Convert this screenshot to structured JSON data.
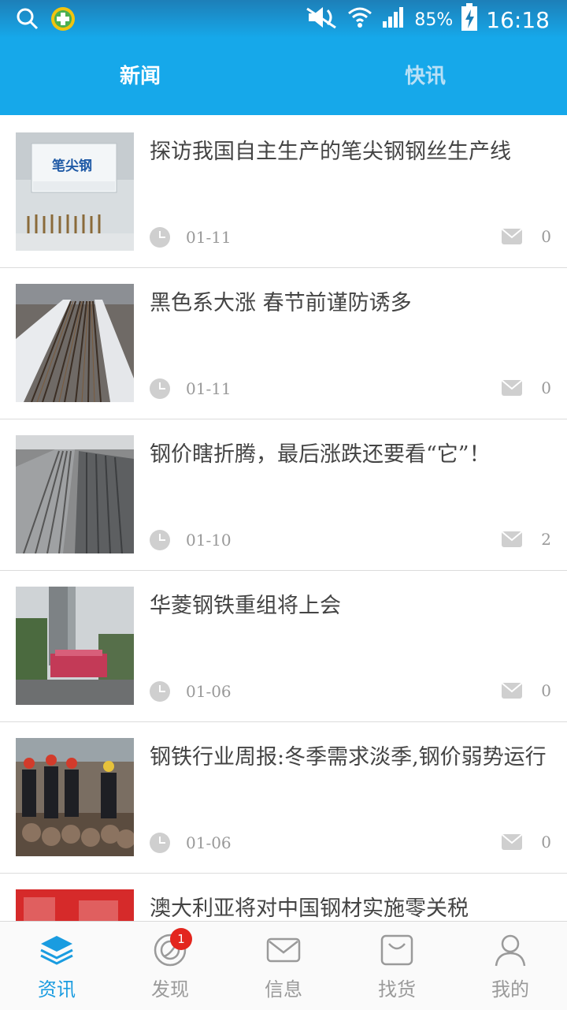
{
  "status_bar": {
    "battery": "85%",
    "time": "16:18"
  },
  "header": {
    "tabs": [
      {
        "label": "新闻",
        "active": true
      },
      {
        "label": "快讯",
        "active": false
      }
    ]
  },
  "news": [
    {
      "title": "探访我国自主生产的笔尖钢钢丝生产线",
      "date": "01-11",
      "comments": "0",
      "thumb_text": "笔尖钢"
    },
    {
      "title": "黑色系大涨 春节前谨防诱多",
      "date": "01-11",
      "comments": "0"
    },
    {
      "title": "钢价瞎折腾，最后涨跌还要看“它”！",
      "date": "01-10",
      "comments": "2"
    },
    {
      "title": "华菱钢铁重组将上会",
      "date": "01-06",
      "comments": "0"
    },
    {
      "title": "钢铁行业周报:冬季需求淡季,钢价弱势运行",
      "date": "01-06",
      "comments": "0"
    },
    {
      "title": "澳大利亚将对中国钢材实施零关税",
      "date": "",
      "comments": ""
    }
  ],
  "tab_bar": [
    {
      "label": "资讯",
      "icon": "layers-icon",
      "active": true
    },
    {
      "label": "发现",
      "icon": "discover-icon",
      "badge": "1"
    },
    {
      "label": "信息",
      "icon": "mail-icon"
    },
    {
      "label": "找货",
      "icon": "bag-icon"
    },
    {
      "label": "我的",
      "icon": "user-icon"
    }
  ],
  "colors": {
    "accent": "#16a8ea",
    "badge": "#e3261e",
    "active_tab": "#1a9ce0"
  }
}
